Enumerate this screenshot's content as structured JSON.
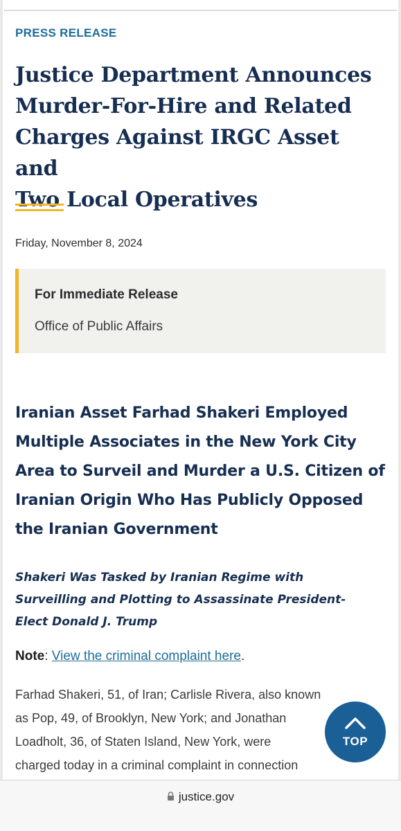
{
  "article": {
    "kicker": "PRESS RELEASE",
    "title_lines": [
      "Justice Department Announces",
      "Murder-For-Hire and Related",
      "Charges Against IRGC Asset and",
      "Two Local Operatives"
    ],
    "date": "Friday, November 8, 2024",
    "release_box": {
      "title": "For Immediate Release",
      "office": "Office of Public Affairs"
    },
    "subhead_lines": [
      "Iranian Asset Farhad Shakeri Employed",
      "Multiple Associates in the New York City",
      "Area to Surveil and Murder a U.S. Citizen of",
      "Iranian Origin Who Has Publicly Opposed",
      "the Iranian Government"
    ],
    "subsubhead_lines": [
      "Shakeri Was Tasked by Iranian Regime with",
      "Surveilling and Plotting to Assassinate President-",
      "Elect Donald J. Trump"
    ],
    "note_label": "Note",
    "note_sep": ": ",
    "note_link": "View the criminal complaint here",
    "note_end": ".",
    "body_lines": [
      "Farhad Shakeri, 51, of Iran; Carlisle Rivera, also known",
      "as Pop, 49, of Brooklyn, New York; and Jonathan",
      "Loadholt, 36, of Staten Island, New York, were",
      "charged today in a criminal complaint in connection"
    ]
  },
  "top_button": {
    "label": "TOP",
    "icon": "chevron-up-icon"
  },
  "browser": {
    "url": "justice.gov",
    "icon": "lock-icon"
  },
  "colors": {
    "navy": "#162e51",
    "link_blue": "#1d6c98",
    "gold": "#f2b526",
    "box_bg": "#f1f1ee",
    "top_button": "#1a5f96"
  }
}
